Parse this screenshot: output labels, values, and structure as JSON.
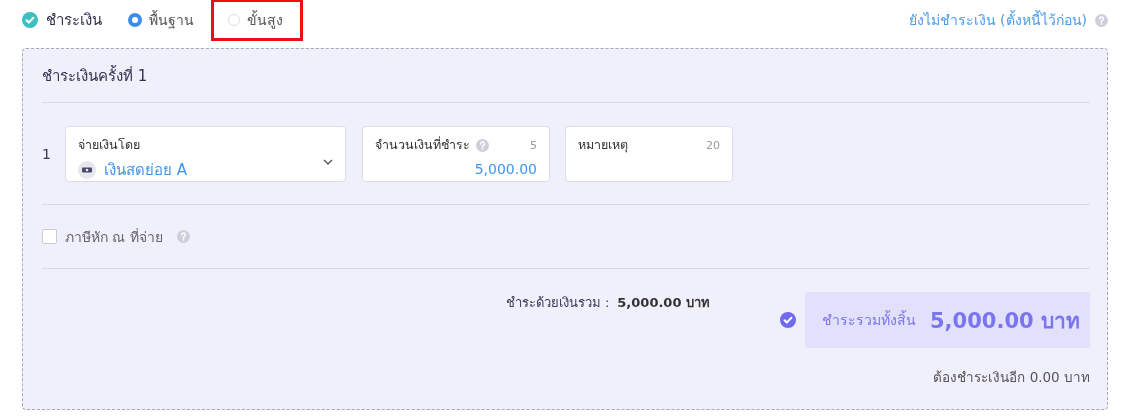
{
  "section": {
    "title": "ชำระเงิน",
    "checked": true
  },
  "modes": [
    {
      "label": "พื้นฐาน",
      "selected": true,
      "highlighted": false
    },
    {
      "label": "ขั้นสูง",
      "selected": false,
      "highlighted": true
    }
  ],
  "defer_link": "ยังไม่ชำระเงิน (ตั้งหนี้ไว้ก่อน)",
  "payment": {
    "title": "ชำระเงินครั้งที่ 1",
    "rows": [
      {
        "index": "1",
        "method": {
          "label": "จ่ายเงินโดย",
          "value": "เงินสดย่อย A"
        },
        "amount": {
          "label": "จำนวนเงินที่ชำระ",
          "count": "5",
          "value": "5,000.00"
        },
        "note": {
          "label": "หมายเหตุ",
          "count": "20"
        }
      }
    ]
  },
  "withholding": {
    "label": "ภาษีหัก ณ ที่จ่าย",
    "checked": false
  },
  "subtotal": {
    "label": "ชำระด้วยเงินรวม :",
    "value": "5,000.00 บาท"
  },
  "total": {
    "label": "ชำระรวมทั้งสิ้น",
    "value": "5,000.00 บาท",
    "confirmed": true
  },
  "remaining": "ต้องชำระเงินอีก 0.00 บาท"
}
